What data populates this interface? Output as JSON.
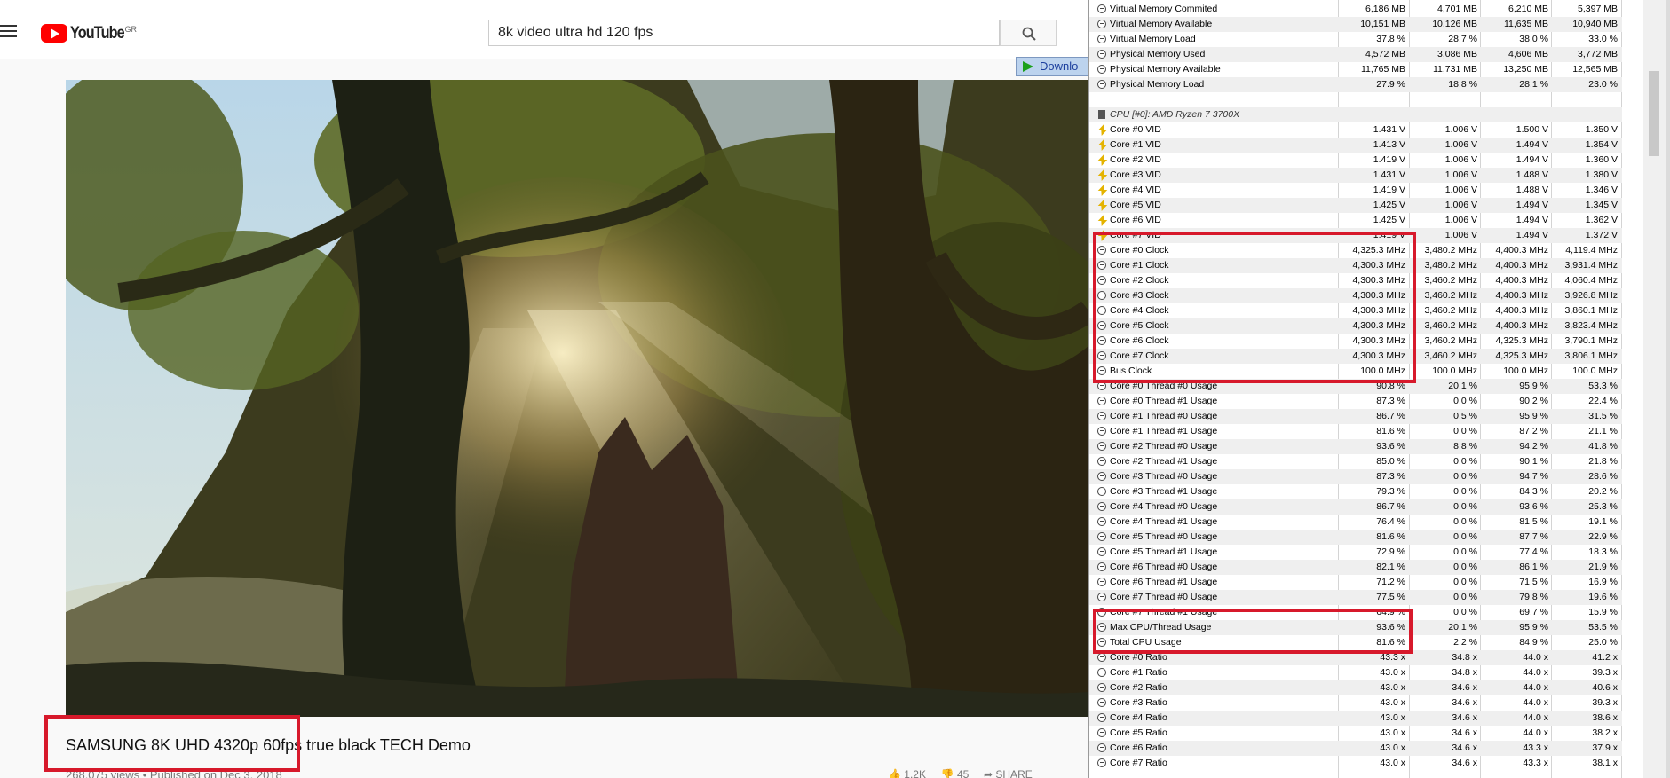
{
  "youtube": {
    "logo_text": "YouTube",
    "logo_country": "GR",
    "search_value": "8k video ultra hd 120 fps",
    "download_label": "Downlo",
    "video_title": "SAMSUNG 8K UHD 4320p 60fps true black TECH Demo",
    "video_meta": "268,075 views • Published on Dec 3, 2018",
    "likes": "1.2K",
    "dislikes": "45",
    "share": "SHARE"
  },
  "hwinfo": {
    "rows": [
      {
        "icon": "clock",
        "label": "Virtual Memory Commited",
        "v": [
          "6,186 MB",
          "4,701 MB",
          "6,210 MB",
          "5,397 MB"
        ]
      },
      {
        "icon": "clock",
        "label": "Virtual Memory Available",
        "v": [
          "10,151 MB",
          "10,126 MB",
          "11,635 MB",
          "10,940 MB"
        ]
      },
      {
        "icon": "clock",
        "label": "Virtual Memory Load",
        "v": [
          "37.8 %",
          "28.7 %",
          "38.0 %",
          "33.0 %"
        ]
      },
      {
        "icon": "clock",
        "label": "Physical Memory Used",
        "v": [
          "4,572 MB",
          "3,086 MB",
          "4,606 MB",
          "3,772 MB"
        ]
      },
      {
        "icon": "clock",
        "label": "Physical Memory Available",
        "v": [
          "11,765 MB",
          "11,731 MB",
          "13,250 MB",
          "12,565 MB"
        ]
      },
      {
        "icon": "clock",
        "label": "Physical Memory Load",
        "v": [
          "27.9 %",
          "18.8 %",
          "28.1 %",
          "23.0 %"
        ]
      },
      {
        "icon": "none",
        "label": "",
        "v": [
          "",
          "",
          "",
          ""
        ]
      },
      {
        "icon": "chip",
        "label": "CPU [#0]: AMD Ryzen 7 3700X",
        "v": [
          "",
          "",
          "",
          ""
        ],
        "section": true
      },
      {
        "icon": "volt",
        "label": "Core #0 VID",
        "v": [
          "1.431 V",
          "1.006 V",
          "1.500 V",
          "1.350 V"
        ]
      },
      {
        "icon": "volt",
        "label": "Core #1 VID",
        "v": [
          "1.413 V",
          "1.006 V",
          "1.494 V",
          "1.354 V"
        ]
      },
      {
        "icon": "volt",
        "label": "Core #2 VID",
        "v": [
          "1.419 V",
          "1.006 V",
          "1.494 V",
          "1.360 V"
        ]
      },
      {
        "icon": "volt",
        "label": "Core #3 VID",
        "v": [
          "1.431 V",
          "1.006 V",
          "1.488 V",
          "1.380 V"
        ]
      },
      {
        "icon": "volt",
        "label": "Core #4 VID",
        "v": [
          "1.419 V",
          "1.006 V",
          "1.488 V",
          "1.346 V"
        ]
      },
      {
        "icon": "volt",
        "label": "Core #5 VID",
        "v": [
          "1.425 V",
          "1.006 V",
          "1.494 V",
          "1.345 V"
        ]
      },
      {
        "icon": "volt",
        "label": "Core #6 VID",
        "v": [
          "1.425 V",
          "1.006 V",
          "1.494 V",
          "1.362 V"
        ]
      },
      {
        "icon": "volt",
        "label": "Core #7 VID",
        "v": [
          "1.419 V",
          "1.006 V",
          "1.494 V",
          "1.372 V"
        ]
      },
      {
        "icon": "clock",
        "label": "Core #0 Clock",
        "v": [
          "4,325.3 MHz",
          "3,480.2 MHz",
          "4,400.3 MHz",
          "4,119.4 MHz"
        ]
      },
      {
        "icon": "clock",
        "label": "Core #1 Clock",
        "v": [
          "4,300.3 MHz",
          "3,480.2 MHz",
          "4,400.3 MHz",
          "3,931.4 MHz"
        ]
      },
      {
        "icon": "clock",
        "label": "Core #2 Clock",
        "v": [
          "4,300.3 MHz",
          "3,460.2 MHz",
          "4,400.3 MHz",
          "4,060.4 MHz"
        ]
      },
      {
        "icon": "clock",
        "label": "Core #3 Clock",
        "v": [
          "4,300.3 MHz",
          "3,460.2 MHz",
          "4,400.3 MHz",
          "3,926.8 MHz"
        ]
      },
      {
        "icon": "clock",
        "label": "Core #4 Clock",
        "v": [
          "4,300.3 MHz",
          "3,460.2 MHz",
          "4,400.3 MHz",
          "3,860.1 MHz"
        ]
      },
      {
        "icon": "clock",
        "label": "Core #5 Clock",
        "v": [
          "4,300.3 MHz",
          "3,460.2 MHz",
          "4,400.3 MHz",
          "3,823.4 MHz"
        ]
      },
      {
        "icon": "clock",
        "label": "Core #6 Clock",
        "v": [
          "4,300.3 MHz",
          "3,460.2 MHz",
          "4,325.3 MHz",
          "3,790.1 MHz"
        ]
      },
      {
        "icon": "clock",
        "label": "Core #7 Clock",
        "v": [
          "4,300.3 MHz",
          "3,460.2 MHz",
          "4,325.3 MHz",
          "3,806.1 MHz"
        ]
      },
      {
        "icon": "clock",
        "label": "Bus Clock",
        "v": [
          "100.0 MHz",
          "100.0 MHz",
          "100.0 MHz",
          "100.0 MHz"
        ]
      },
      {
        "icon": "clock",
        "label": "Core #0 Thread #0 Usage",
        "v": [
          "90.8 %",
          "20.1 %",
          "95.9 %",
          "53.3 %"
        ]
      },
      {
        "icon": "clock",
        "label": "Core #0 Thread #1 Usage",
        "v": [
          "87.3 %",
          "0.0 %",
          "90.2 %",
          "22.4 %"
        ]
      },
      {
        "icon": "clock",
        "label": "Core #1 Thread #0 Usage",
        "v": [
          "86.7 %",
          "0.5 %",
          "95.9 %",
          "31.5 %"
        ]
      },
      {
        "icon": "clock",
        "label": "Core #1 Thread #1 Usage",
        "v": [
          "81.6 %",
          "0.0 %",
          "87.2 %",
          "21.1 %"
        ]
      },
      {
        "icon": "clock",
        "label": "Core #2 Thread #0 Usage",
        "v": [
          "93.6 %",
          "8.8 %",
          "94.2 %",
          "41.8 %"
        ]
      },
      {
        "icon": "clock",
        "label": "Core #2 Thread #1 Usage",
        "v": [
          "85.0 %",
          "0.0 %",
          "90.1 %",
          "21.8 %"
        ]
      },
      {
        "icon": "clock",
        "label": "Core #3 Thread #0 Usage",
        "v": [
          "87.3 %",
          "0.0 %",
          "94.7 %",
          "28.6 %"
        ]
      },
      {
        "icon": "clock",
        "label": "Core #3 Thread #1 Usage",
        "v": [
          "79.3 %",
          "0.0 %",
          "84.3 %",
          "20.2 %"
        ]
      },
      {
        "icon": "clock",
        "label": "Core #4 Thread #0 Usage",
        "v": [
          "86.7 %",
          "0.0 %",
          "93.6 %",
          "25.3 %"
        ]
      },
      {
        "icon": "clock",
        "label": "Core #4 Thread #1 Usage",
        "v": [
          "76.4 %",
          "0.0 %",
          "81.5 %",
          "19.1 %"
        ]
      },
      {
        "icon": "clock",
        "label": "Core #5 Thread #0 Usage",
        "v": [
          "81.6 %",
          "0.0 %",
          "87.7 %",
          "22.9 %"
        ]
      },
      {
        "icon": "clock",
        "label": "Core #5 Thread #1 Usage",
        "v": [
          "72.9 %",
          "0.0 %",
          "77.4 %",
          "18.3 %"
        ]
      },
      {
        "icon": "clock",
        "label": "Core #6 Thread #0 Usage",
        "v": [
          "82.1 %",
          "0.0 %",
          "86.1 %",
          "21.9 %"
        ]
      },
      {
        "icon": "clock",
        "label": "Core #6 Thread #1 Usage",
        "v": [
          "71.2 %",
          "0.0 %",
          "71.5 %",
          "16.9 %"
        ]
      },
      {
        "icon": "clock",
        "label": "Core #7 Thread #0 Usage",
        "v": [
          "77.5 %",
          "0.0 %",
          "79.8 %",
          "19.6 %"
        ]
      },
      {
        "icon": "clock",
        "label": "Core #7 Thread #1 Usage",
        "v": [
          "64.9 %",
          "0.0 %",
          "69.7 %",
          "15.9 %"
        ]
      },
      {
        "icon": "clock",
        "label": "Max CPU/Thread Usage",
        "v": [
          "93.6 %",
          "20.1 %",
          "95.9 %",
          "53.5 %"
        ]
      },
      {
        "icon": "clock",
        "label": "Total CPU Usage",
        "v": [
          "81.6 %",
          "2.2 %",
          "84.9 %",
          "25.0 %"
        ]
      },
      {
        "icon": "clock",
        "label": "Core #0 Ratio",
        "v": [
          "43.3 x",
          "34.8 x",
          "44.0 x",
          "41.2 x"
        ]
      },
      {
        "icon": "clock",
        "label": "Core #1 Ratio",
        "v": [
          "43.0 x",
          "34.8 x",
          "44.0 x",
          "39.3 x"
        ]
      },
      {
        "icon": "clock",
        "label": "Core #2 Ratio",
        "v": [
          "43.0 x",
          "34.6 x",
          "44.0 x",
          "40.6 x"
        ]
      },
      {
        "icon": "clock",
        "label": "Core #3 Ratio",
        "v": [
          "43.0 x",
          "34.6 x",
          "44.0 x",
          "39.3 x"
        ]
      },
      {
        "icon": "clock",
        "label": "Core #4 Ratio",
        "v": [
          "43.0 x",
          "34.6 x",
          "44.0 x",
          "38.6 x"
        ]
      },
      {
        "icon": "clock",
        "label": "Core #5 Ratio",
        "v": [
          "43.0 x",
          "34.6 x",
          "44.0 x",
          "38.2 x"
        ]
      },
      {
        "icon": "clock",
        "label": "Core #6 Ratio",
        "v": [
          "43.0 x",
          "34.6 x",
          "43.3 x",
          "37.9 x"
        ]
      },
      {
        "icon": "clock",
        "label": "Core #7 Ratio",
        "v": [
          "43.0 x",
          "34.6 x",
          "43.3 x",
          "38.1 x"
        ]
      }
    ]
  },
  "colors": {
    "highlight": "#d7192b",
    "youtube_red": "#ff0000"
  }
}
